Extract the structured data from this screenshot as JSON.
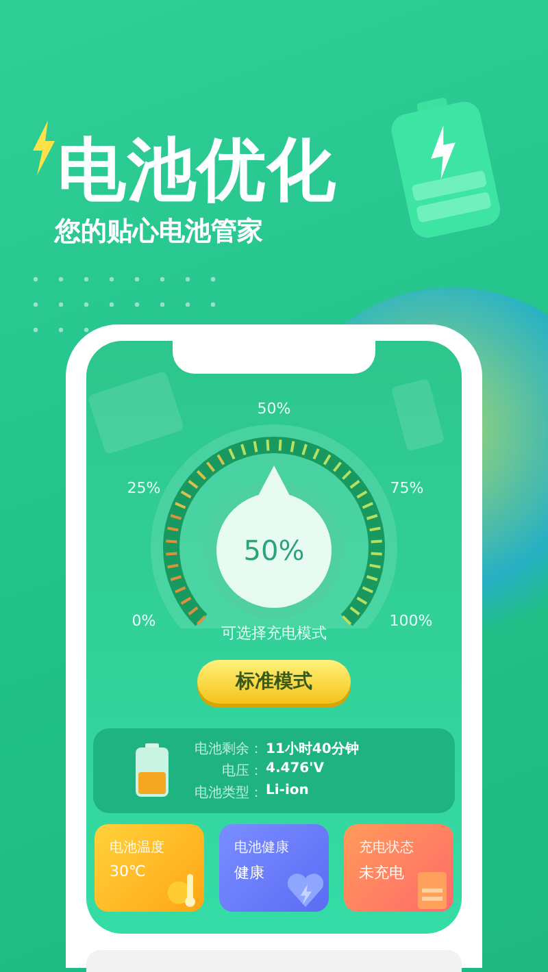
{
  "header": {
    "title": "电池优化",
    "subtitle": "您的贴心电池管家"
  },
  "gauge": {
    "level": 0.5,
    "reading": "50%",
    "scale_labels": [
      "0%",
      "25%",
      "50%",
      "75%",
      "100%"
    ],
    "caption": "可选择充电模式"
  },
  "mode_button": {
    "label": "标准模式"
  },
  "battery_info": {
    "level": 0.5,
    "rows": [
      {
        "label": "电池剩余：",
        "value": "11小时40分钟"
      },
      {
        "label": "电压：",
        "value": "4.476'V"
      },
      {
        "label": "电池类型：",
        "value": "Li-ion"
      }
    ]
  },
  "tiles": [
    {
      "kind": "temperature",
      "label": "电池温度",
      "value": "30℃"
    },
    {
      "kind": "health",
      "label": "电池健康",
      "value": "健康"
    },
    {
      "kind": "charging",
      "label": "充电状态",
      "value": "未充电"
    }
  ]
}
